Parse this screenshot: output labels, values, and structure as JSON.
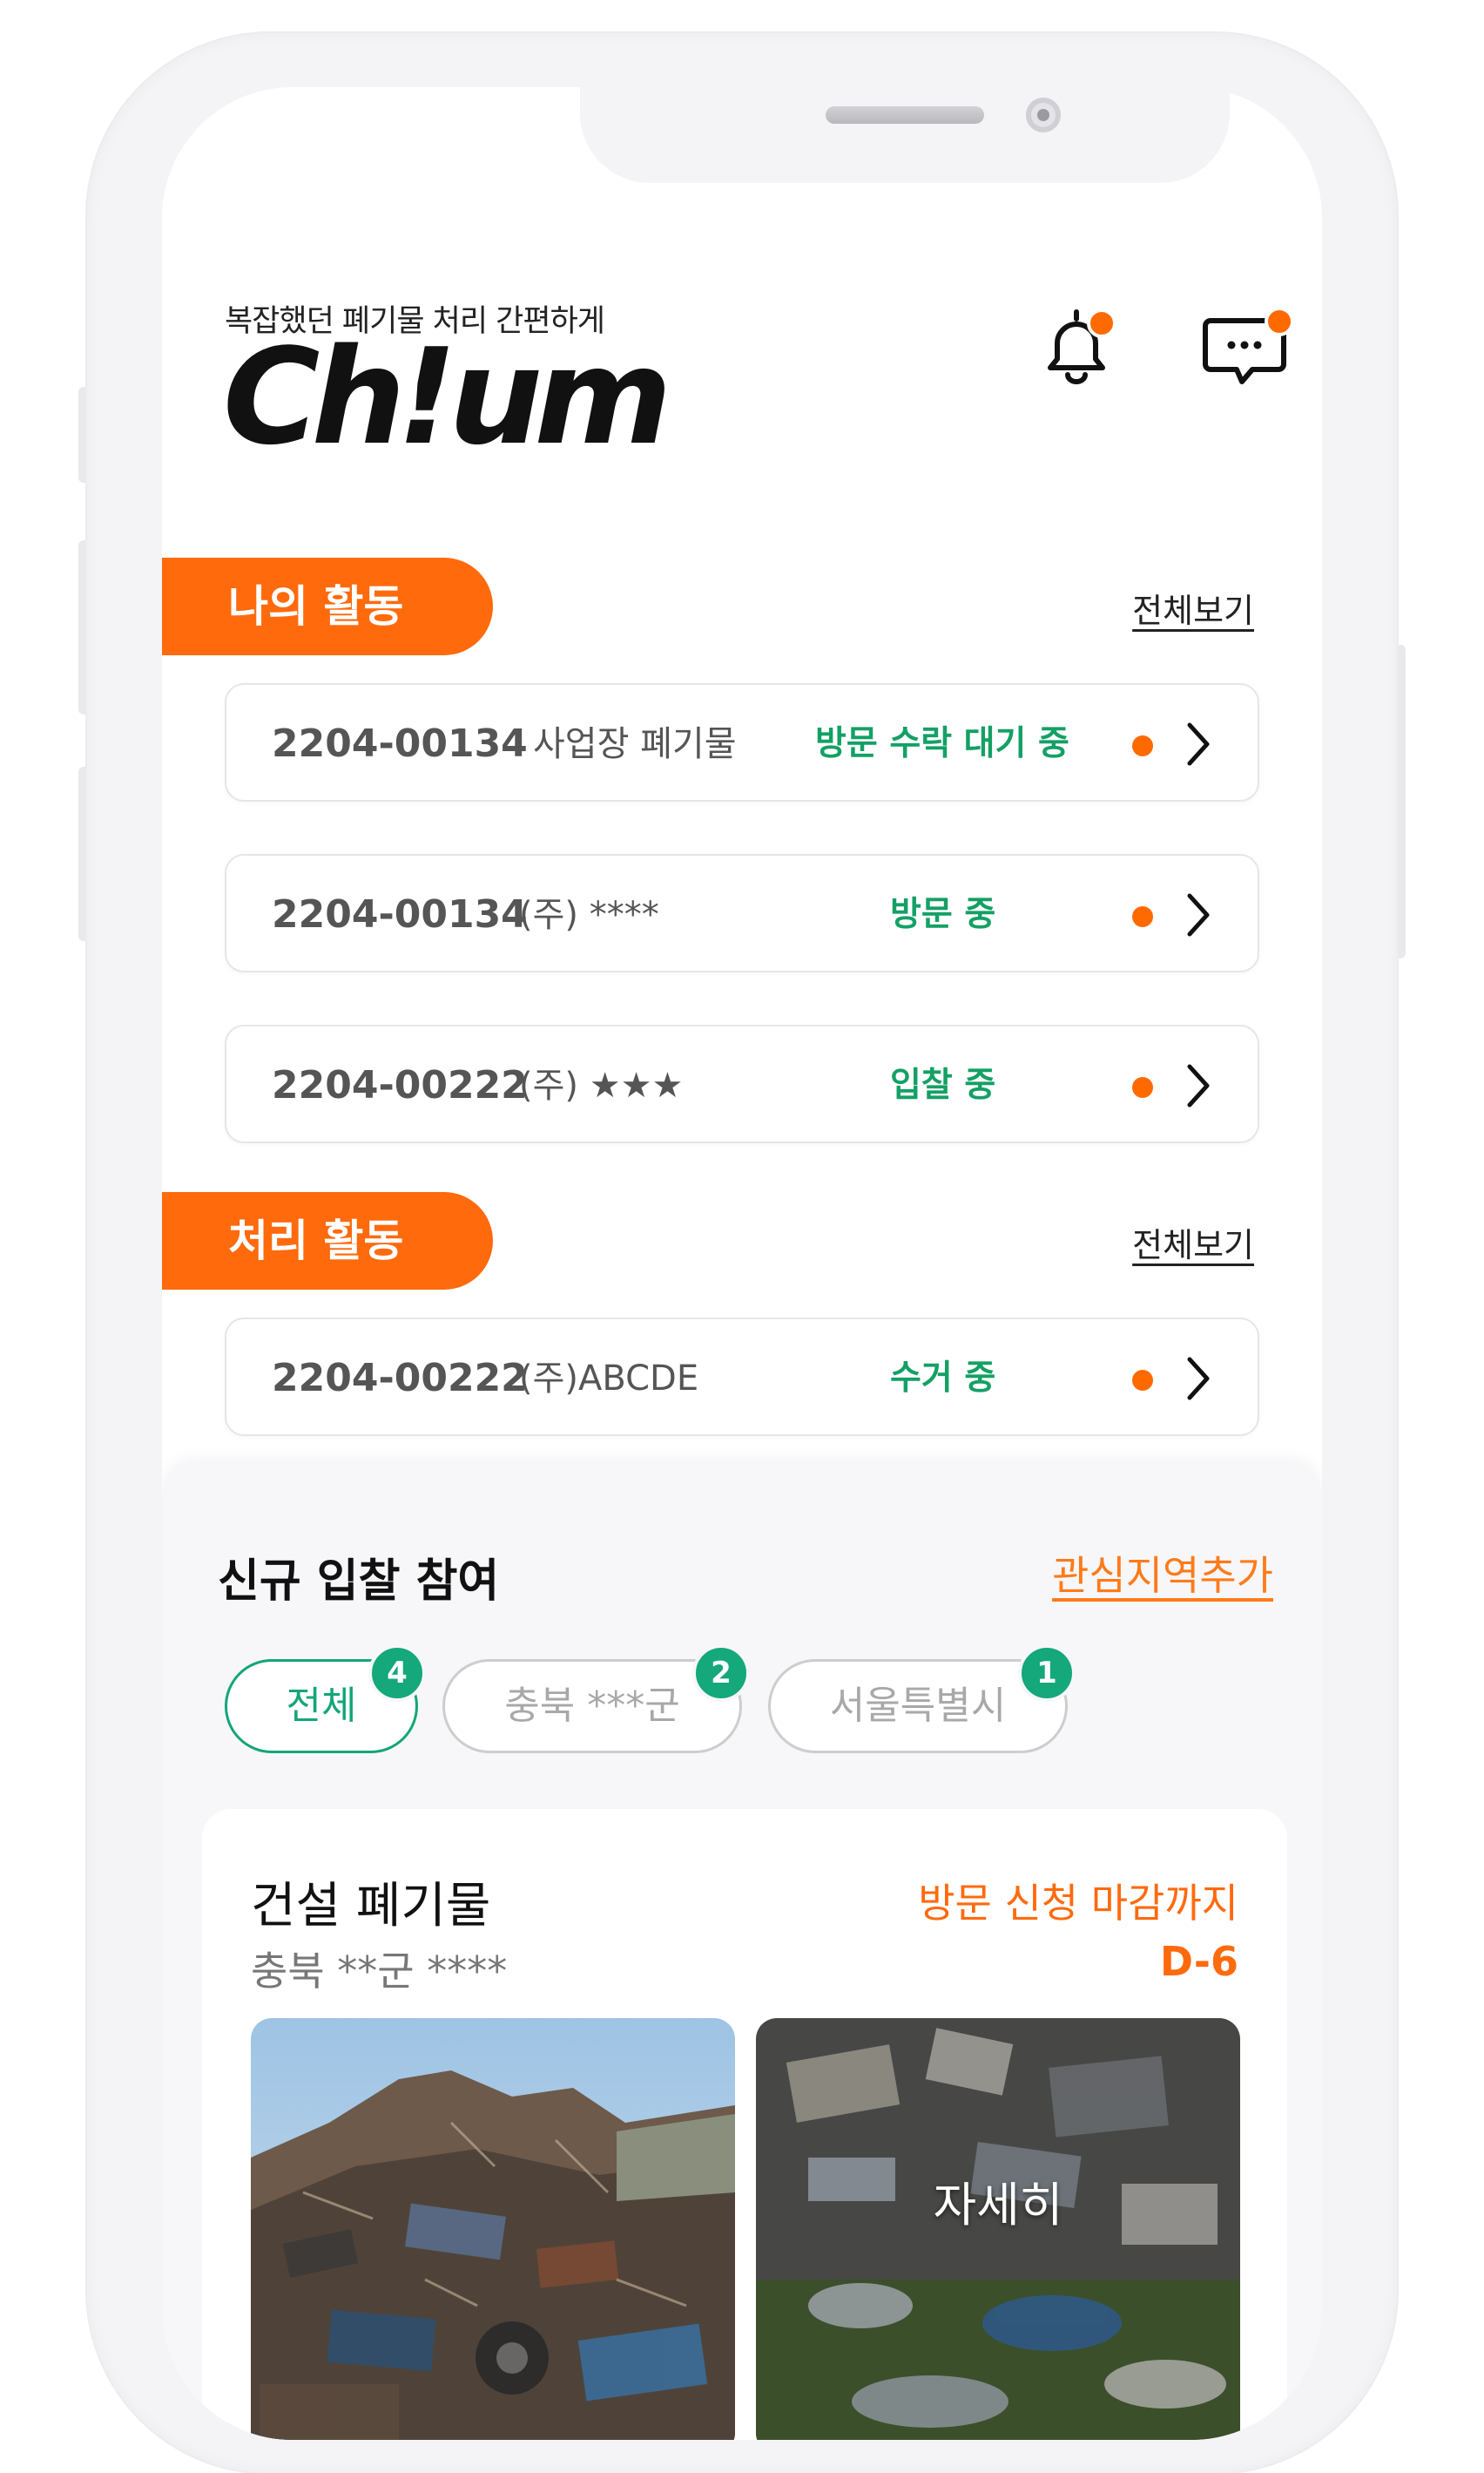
{
  "header": {
    "tagline": "복잡했던 폐기물 처리 간편하게",
    "logo": "Ch!um",
    "notification_icon": "bell-icon",
    "chat_icon": "chat-bubble-icon"
  },
  "my_activity": {
    "title": "나의 활동",
    "view_all": "전체보기",
    "items": [
      {
        "number": "2204-00134",
        "name": "사업장 폐기물",
        "status": "방문 수락 대기 중"
      },
      {
        "number": "2204-00134",
        "name": "(주) ****",
        "status": "방문 중"
      },
      {
        "number": "2204-00222",
        "name": "(주) ★★★",
        "status": "입찰 중"
      }
    ]
  },
  "processing_activity": {
    "title": "처리 활동",
    "view_all": "전체보기",
    "items": [
      {
        "number": "2204-00222",
        "name": "(주)ABCDE",
        "status": "수거 중"
      }
    ]
  },
  "new_bids": {
    "title": "신규 입찰 참여",
    "add_region": "관심지역추가",
    "filters": [
      {
        "label": "전체",
        "count": "4",
        "active": true
      },
      {
        "label": "충북 ***군",
        "count": "2",
        "active": false
      },
      {
        "label": "서울특별시",
        "count": "1",
        "active": false
      }
    ],
    "card": {
      "title": "건설 폐기물",
      "location": "충북 **군 ****",
      "deadline_label": "방문 신청 마감까지",
      "d_day": "D-6",
      "detail_label": "자세히"
    }
  },
  "colors": {
    "accent_orange": "#ff6a0d",
    "status_green": "#14a065",
    "chip_green": "#14a578"
  }
}
